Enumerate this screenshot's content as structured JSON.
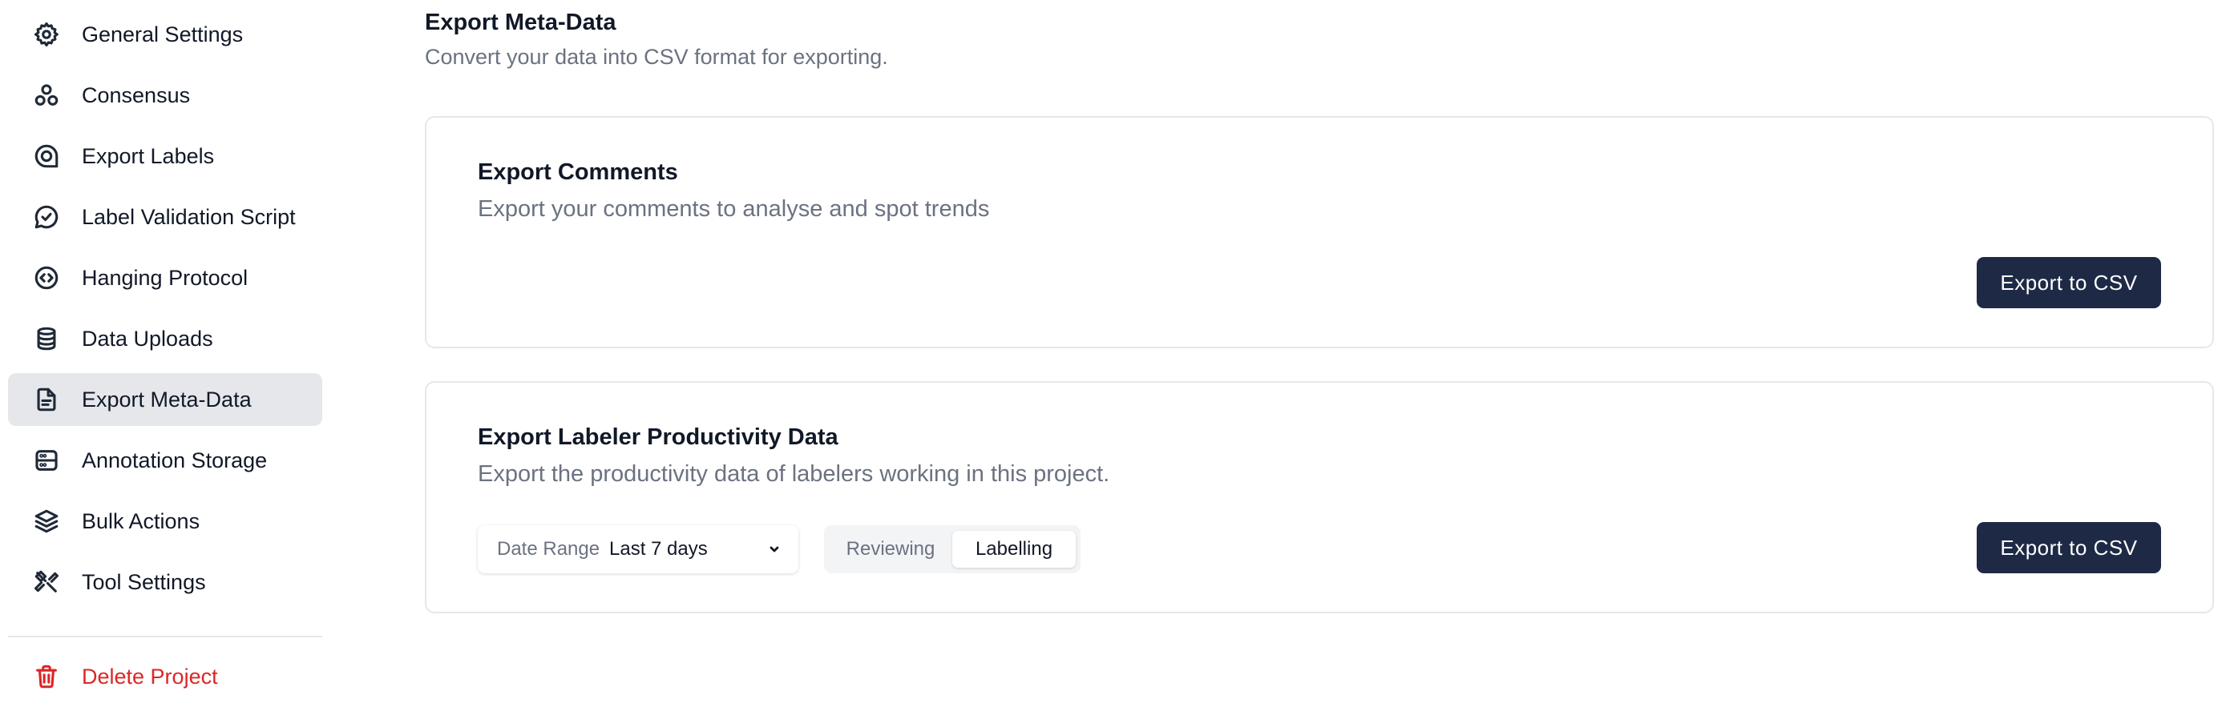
{
  "sidebar": {
    "items": [
      {
        "label": "General Settings",
        "icon": "gear-icon"
      },
      {
        "label": "Consensus",
        "icon": "consensus-icon"
      },
      {
        "label": "Export Labels",
        "icon": "export-labels-icon"
      },
      {
        "label": "Label Validation Script",
        "icon": "chat-check-icon"
      },
      {
        "label": "Hanging Protocol",
        "icon": "code-circle-icon"
      },
      {
        "label": "Data Uploads",
        "icon": "database-icon"
      },
      {
        "label": "Export Meta-Data",
        "icon": "file-icon",
        "active": true
      },
      {
        "label": "Annotation Storage",
        "icon": "server-icon"
      },
      {
        "label": "Bulk Actions",
        "icon": "layers-icon"
      },
      {
        "label": "Tool Settings",
        "icon": "tools-icon"
      }
    ],
    "delete": {
      "label": "Delete Project",
      "icon": "trash-icon",
      "color": "#dc2626"
    }
  },
  "header": {
    "title": "Export Meta-Data",
    "subtitle": "Convert your data into CSV format for exporting."
  },
  "comments_card": {
    "title": "Export Comments",
    "description": "Export your comments to analyse and spot trends",
    "button_label": "Export to CSV"
  },
  "productivity_card": {
    "title": "Export Labeler Productivity Data",
    "description": "Export the productivity data of labelers working in this project.",
    "date_range": {
      "label": "Date Range",
      "value": "Last 7 days"
    },
    "mode_toggle": {
      "options": [
        "Reviewing",
        "Labelling"
      ],
      "selected": "Labelling"
    },
    "button_label": "Export to CSV"
  },
  "colors": {
    "primary_button": "#1e2a45",
    "active_nav": "#e5e7eb",
    "danger": "#dc2626",
    "muted_text": "#6b7280"
  }
}
